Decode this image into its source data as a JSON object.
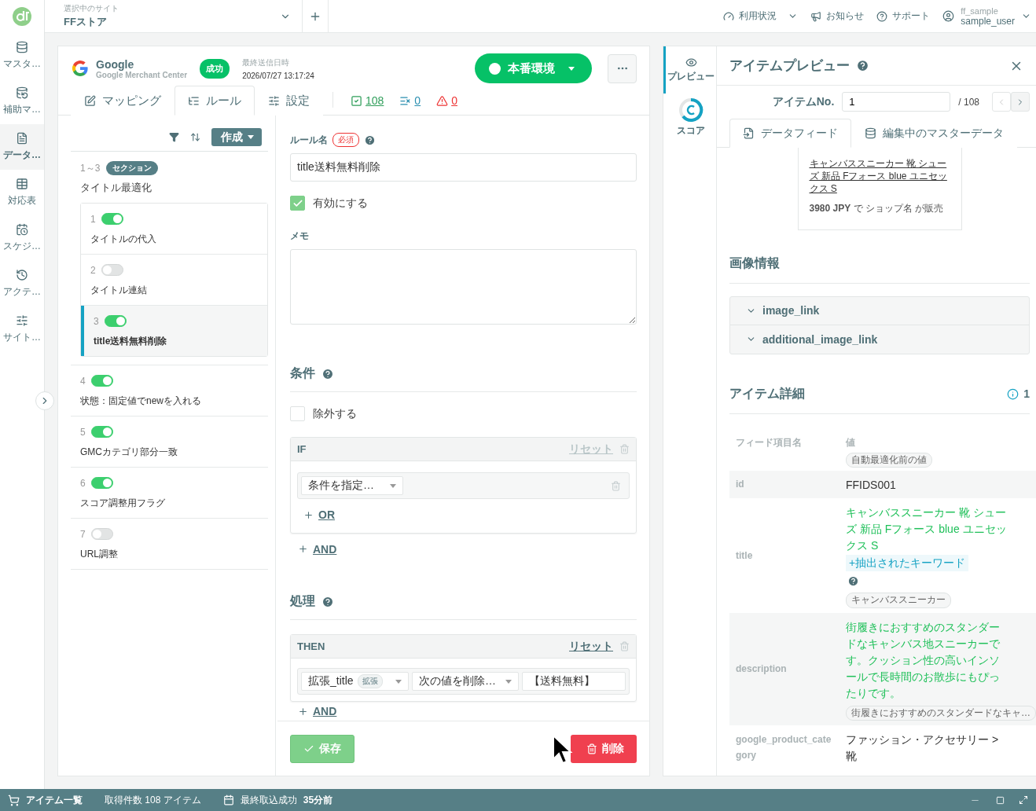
{
  "sidebar": {
    "items": [
      {
        "label": "マスタ…",
        "selected": false
      },
      {
        "label": "補助マ…",
        "selected": false
      },
      {
        "label": "データ…",
        "selected": true
      },
      {
        "label": "対応表",
        "selected": false
      },
      {
        "label": "スケジ…",
        "selected": false
      },
      {
        "label": "アクテ…",
        "selected": false
      },
      {
        "label": "サイト…",
        "selected": false
      }
    ]
  },
  "header": {
    "site_caption": "選択中のサイト",
    "site_name": "FFストア",
    "menu": [
      {
        "label": "利用状況",
        "dropdown": true
      },
      {
        "label": "お知らせ",
        "dropdown": false
      },
      {
        "label": "サポート",
        "dropdown": false
      }
    ],
    "user": {
      "org": "ff_sample",
      "name": "sample_user"
    }
  },
  "feed": {
    "name": "Google",
    "service": "Google Merchant Center",
    "status": "成功",
    "last_sent_caption": "最終送信日時",
    "last_sent": "2026/07/27 13:17:24",
    "environment": "本番環境"
  },
  "tabs": [
    {
      "label": "マッピング",
      "selected": false
    },
    {
      "label": "ルール",
      "selected": true
    },
    {
      "label": "設定",
      "selected": false
    }
  ],
  "counters": [
    {
      "kind": "valid",
      "count": "108"
    },
    {
      "kind": "excluded",
      "count": "0"
    },
    {
      "kind": "warning",
      "count": "0"
    }
  ],
  "rule_list": {
    "create": "作成",
    "items": [
      {
        "kind": "section",
        "range": "1～3",
        "badge": "セクション",
        "name": "タイトル最適化",
        "children": [
          {
            "kind": "rule",
            "number": "1",
            "on": true,
            "name": "タイトルの代入",
            "selected": false
          },
          {
            "kind": "rule",
            "number": "2",
            "on": false,
            "name": "タイトル連結",
            "selected": false
          },
          {
            "kind": "rule",
            "number": "3",
            "on": true,
            "name": "title送料無料削除",
            "selected": true
          }
        ]
      },
      {
        "kind": "rule",
        "number": "4",
        "on": true,
        "name": "状態：固定値でnewを入れる",
        "selected": false
      },
      {
        "kind": "rule",
        "number": "5",
        "on": true,
        "name": "GMCカテゴリ部分一致",
        "selected": false
      },
      {
        "kind": "rule",
        "number": "6",
        "on": true,
        "name": "スコア調整用フラグ",
        "selected": false
      },
      {
        "kind": "rule",
        "number": "7",
        "on": false,
        "name": "URL調整",
        "selected": false
      }
    ]
  },
  "rule_form": {
    "name_label": "ルール名",
    "required": "必須",
    "name": "title送料無料削除",
    "enabled": {
      "label": "有効にする",
      "checked": true
    },
    "memo_label": "メモ",
    "conditions": {
      "title": "条件",
      "exclude": {
        "label": "除外する",
        "checked": false
      },
      "block": {
        "label": "IF",
        "reset": {
          "label": "リセット",
          "disabled": true
        },
        "condition_placeholder": "条件を指定…",
        "or": "OR"
      },
      "and": "AND"
    },
    "actions": {
      "title": "処理",
      "block": {
        "label": "THEN",
        "reset": {
          "label": "リセット",
          "disabled": false
        },
        "field": "拡張_title",
        "field_badge": "拡張",
        "operation": "次の値を削除…",
        "value": "【送料無料】"
      },
      "and": "AND"
    },
    "save": "保存",
    "delete": "削除"
  },
  "preview": {
    "tabs": [
      {
        "label": "プレビュー",
        "selected": true
      },
      {
        "label": "スコア",
        "selected": false
      }
    ],
    "title": "アイテムプレビュー",
    "item_no_label": "アイテムNo.",
    "item_no": "1",
    "item_total": "/ 108",
    "views": [
      {
        "label": "データフィード",
        "selected": true
      },
      {
        "label": "編集中のマスターデータ",
        "selected": false
      }
    ],
    "card": {
      "title": "キャンバススニーカー 靴 シューズ 新品 Fフォース blue ユニセックス S",
      "price_line": "**3980 JPY** で ショップ名 が販売"
    },
    "image_section": {
      "title": "画像情報",
      "fields": [
        "image_link",
        "additional_image_link"
      ]
    },
    "details": {
      "title": "アイテム詳細",
      "info_count": "1",
      "field_header": "フィード項目名",
      "value_header": "値",
      "value_note": "自動最適化前の値",
      "rows": [
        {
          "field": "id",
          "value": "FFIDS001",
          "changed": false
        },
        {
          "field": "title",
          "value": "キャンバススニーカー 靴 シューズ 新品 Fフォース blue ユニセックス S",
          "changed": true,
          "extra": "+抽出されたキーワード",
          "original": "キャンバススニーカー"
        },
        {
          "field": "description",
          "value": "街履きにおすすめのスタンダードなキャンバス地スニーカーです。クッション性の高いインソールで長時間のお散歩にもぴったりです。",
          "changed": true,
          "original": "街履きにおすすめのスタンダードなキャ…"
        },
        {
          "field": "google_product_category",
          "value": "ファッション・アクセサリー > 靴",
          "changed": false
        }
      ]
    }
  },
  "status_bar": {
    "items_label": "アイテム一覧",
    "count": "取得件数 108 アイテム",
    "last_import_label": "最終取込成功",
    "last_import": "35分前"
  }
}
